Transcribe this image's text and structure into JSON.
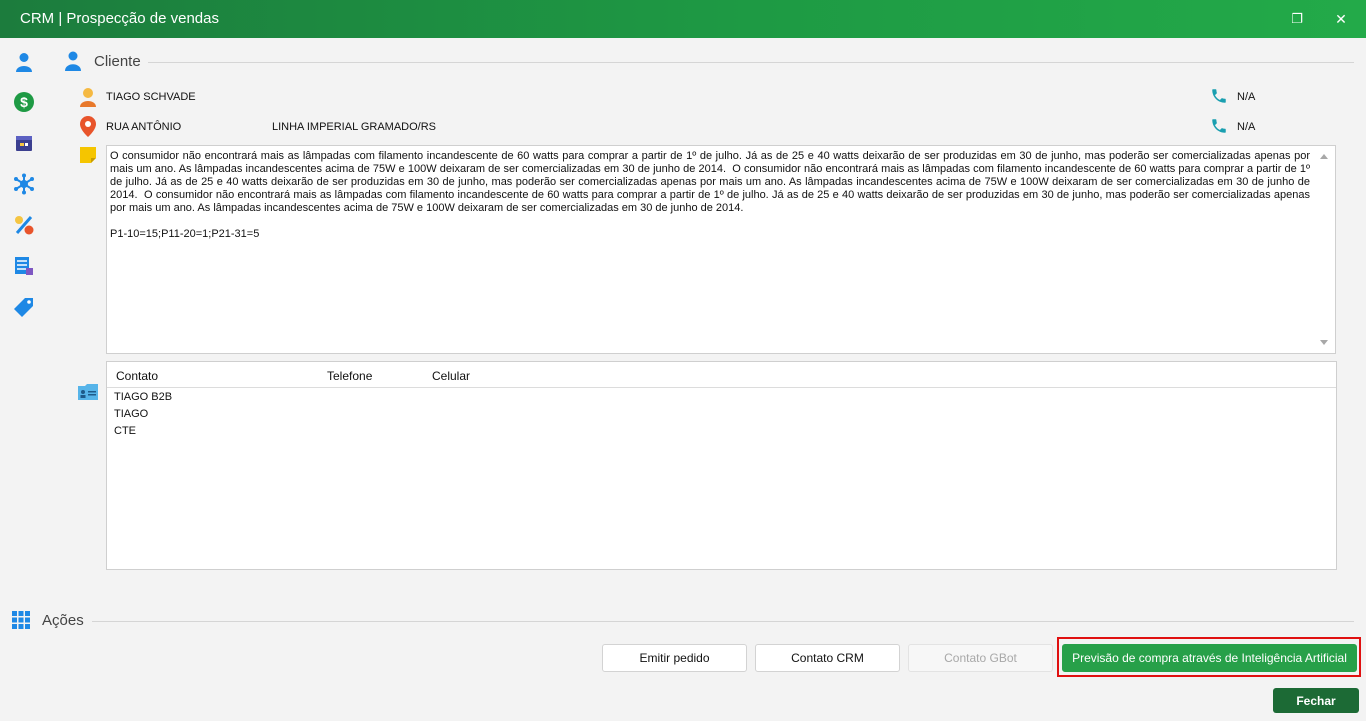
{
  "window": {
    "title": "CRM | Prospecção de vendas",
    "restore_symbol": "❐",
    "close_symbol": "✕"
  },
  "sidebar": {
    "items": [
      {
        "icon": "person-icon"
      },
      {
        "icon": "dollar-icon"
      },
      {
        "icon": "calendar-icon"
      },
      {
        "icon": "network-icon"
      },
      {
        "icon": "discount-icon"
      },
      {
        "icon": "list-icon"
      },
      {
        "icon": "tag-icon"
      }
    ]
  },
  "cliente": {
    "section_title": "Cliente",
    "name": "TIAGO SCHVADE",
    "address": "RUA ANTÔNIO",
    "city": "LINHA IMPERIAL GRAMADO/RS",
    "phone1": "N/A",
    "phone2": "N/A",
    "notes": "O consumidor não encontrará mais as lâmpadas com filamento incandescente de 60 watts para comprar a partir de 1º de julho. Já as de 25 e 40 watts deixarão de ser produzidas em 30 de junho, mas poderão ser comercializadas apenas por mais um ano. As lâmpadas incandescentes acima de 75W e 100W deixaram de ser comercializadas em 30 de junho de 2014.  O consumidor não encontrará mais as lâmpadas com filamento incandescente de 60 watts para comprar a partir de 1º de julho. Já as de 25 e 40 watts deixarão de ser produzidas em 30 de junho, mas poderão ser comercializadas apenas por mais um ano. As lâmpadas incandescentes acima de 75W e 100W deixaram de ser comercializadas em 30 de junho de 2014.  O consumidor não encontrará mais as lâmpadas com filamento incandescente de 60 watts para comprar a partir de 1º de julho. Já as de 25 e 40 watts deixarão de ser produzidas em 30 de junho, mas poderão ser comercializadas apenas por mais um ano. As lâmpadas incandescentes acima de 75W e 100W deixaram de ser comercializadas em 30 de junho de 2014.\n\nP1-10=15;P11-20=1;P21-31=5"
  },
  "contacts": {
    "headers": [
      "Contato",
      "Telefone",
      "Celular"
    ],
    "rows": [
      {
        "contato": "TIAGO B2B",
        "telefone": "",
        "celular": ""
      },
      {
        "contato": "TIAGO",
        "telefone": "",
        "celular": ""
      },
      {
        "contato": "CTE",
        "telefone": "",
        "celular": ""
      }
    ]
  },
  "acoes": {
    "section_title": "Ações",
    "emitir_pedido": "Emitir pedido",
    "contato_crm": "Contato CRM",
    "contato_gbot": "Contato GBot",
    "previsao": "Previsão de compra através de Inteligência Artificial",
    "fechar": "Fechar"
  },
  "colors": {
    "accent": "#27a049",
    "title_bar": "#1e9a44",
    "highlight": "#e01010",
    "close_button": "#1c6a35"
  }
}
